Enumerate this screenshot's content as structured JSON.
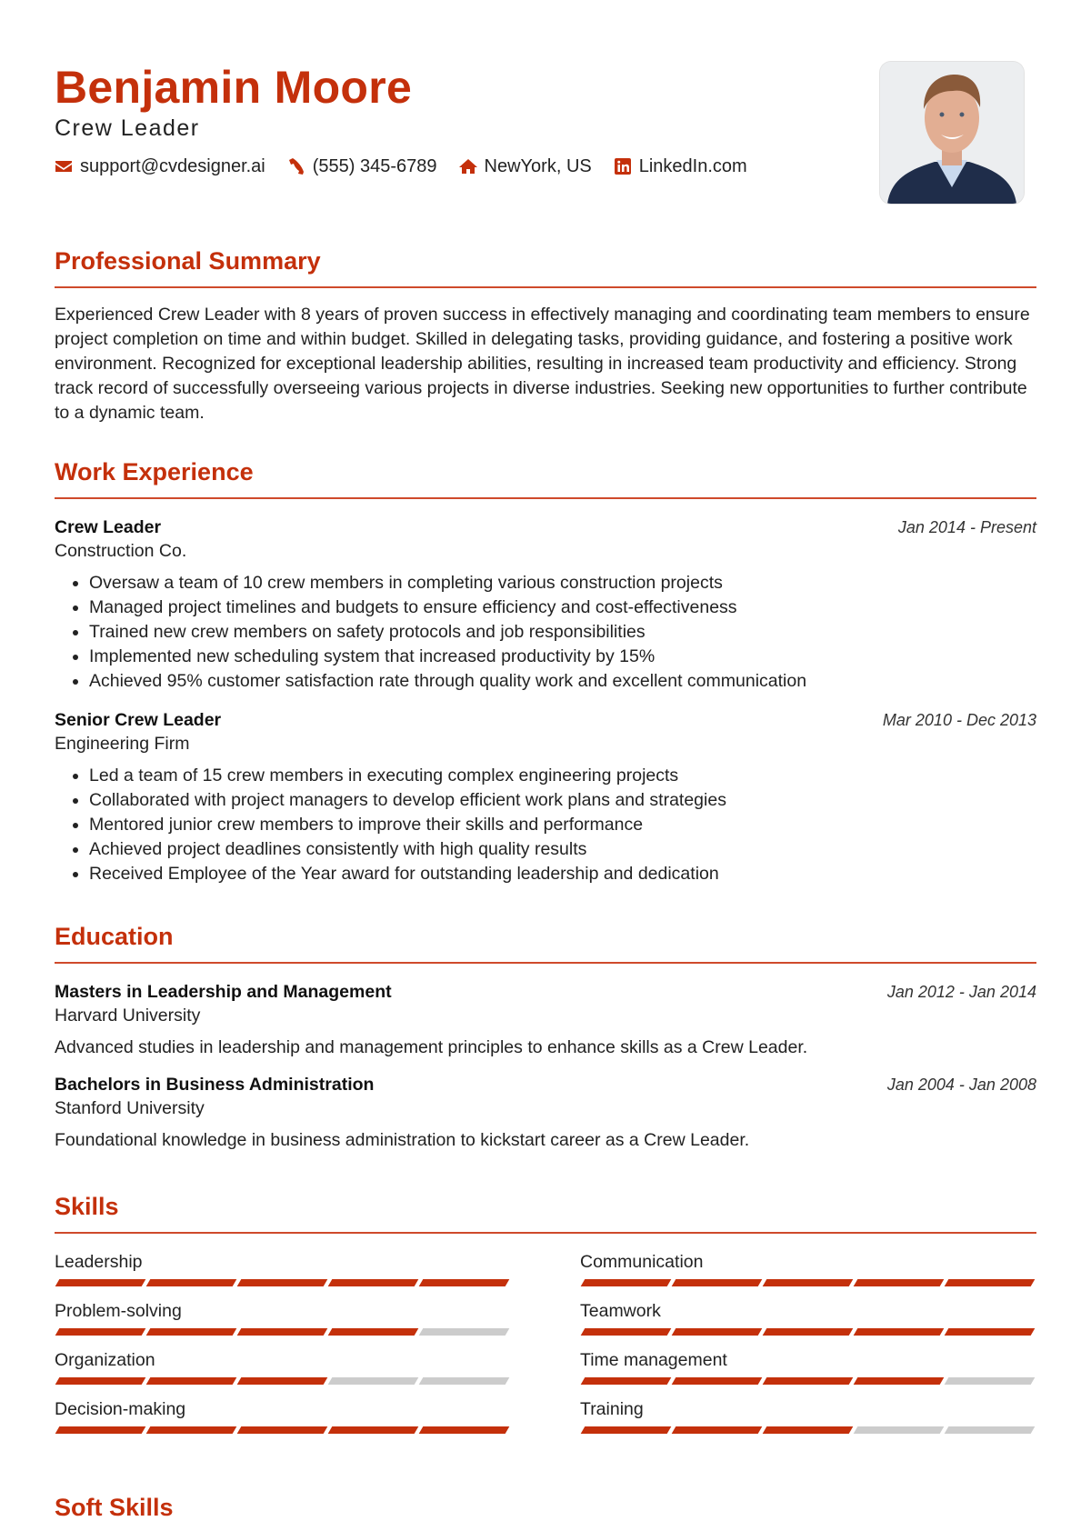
{
  "header": {
    "name": "Benjamin Moore",
    "title": "Crew Leader",
    "contacts": [
      {
        "icon": "envelope-icon",
        "text": "support@cvdesigner.ai"
      },
      {
        "icon": "phone-icon",
        "text": "(555) 345-6789"
      },
      {
        "icon": "home-icon",
        "text": "NewYork, US"
      },
      {
        "icon": "linkedin-icon",
        "text": "LinkedIn.com"
      }
    ]
  },
  "accent_color": "#c4300b",
  "summary": {
    "heading": "Professional Summary",
    "text": "Experienced Crew Leader with 8 years of proven success in effectively managing and coordinating team members to ensure project completion on time and within budget. Skilled in delegating tasks, providing guidance, and fostering a positive work environment. Recognized for exceptional leadership abilities, resulting in increased team productivity and efficiency. Strong track record of successfully overseeing various projects in diverse industries. Seeking new opportunities to further contribute to a dynamic team."
  },
  "experience": {
    "heading": "Work Experience",
    "jobs": [
      {
        "title": "Crew Leader",
        "company": "Construction Co.",
        "dates": "Jan 2014 - Present",
        "bullets": [
          "Oversaw a team of 10 crew members in completing various construction projects",
          "Managed project timelines and budgets to ensure efficiency and cost-effectiveness",
          "Trained new crew members on safety protocols and job responsibilities",
          "Implemented new scheduling system that increased productivity by 15%",
          "Achieved 95% customer satisfaction rate through quality work and excellent communication"
        ]
      },
      {
        "title": "Senior Crew Leader",
        "company": "Engineering Firm",
        "dates": "Mar 2010 - Dec 2013",
        "bullets": [
          "Led a team of 15 crew members in executing complex engineering projects",
          "Collaborated with project managers to develop efficient work plans and strategies",
          "Mentored junior crew members to improve their skills and performance",
          "Achieved project deadlines consistently with high quality results",
          "Received Employee of the Year award for outstanding leadership and dedication"
        ]
      }
    ]
  },
  "education": {
    "heading": "Education",
    "items": [
      {
        "degree": "Masters in Leadership and Management",
        "school": "Harvard University",
        "dates": "Jan 2012 - Jan 2014",
        "description": "Advanced studies in leadership and management principles to enhance skills as a Crew Leader."
      },
      {
        "degree": "Bachelors in Business Administration",
        "school": "Stanford University",
        "dates": "Jan 2004 - Jan 2008",
        "description": "Foundational knowledge in business administration to kickstart career as a Crew Leader."
      }
    ]
  },
  "skills": {
    "heading": "Skills",
    "max_level": 5,
    "items": [
      {
        "name": "Leadership",
        "level": 5
      },
      {
        "name": "Communication",
        "level": 5
      },
      {
        "name": "Problem-solving",
        "level": 4
      },
      {
        "name": "Teamwork",
        "level": 5
      },
      {
        "name": "Organization",
        "level": 3
      },
      {
        "name": "Time management",
        "level": 4
      },
      {
        "name": "Decision-making",
        "level": 5
      },
      {
        "name": "Training",
        "level": 3
      }
    ]
  },
  "soft_skills": {
    "heading": "Soft Skills"
  }
}
